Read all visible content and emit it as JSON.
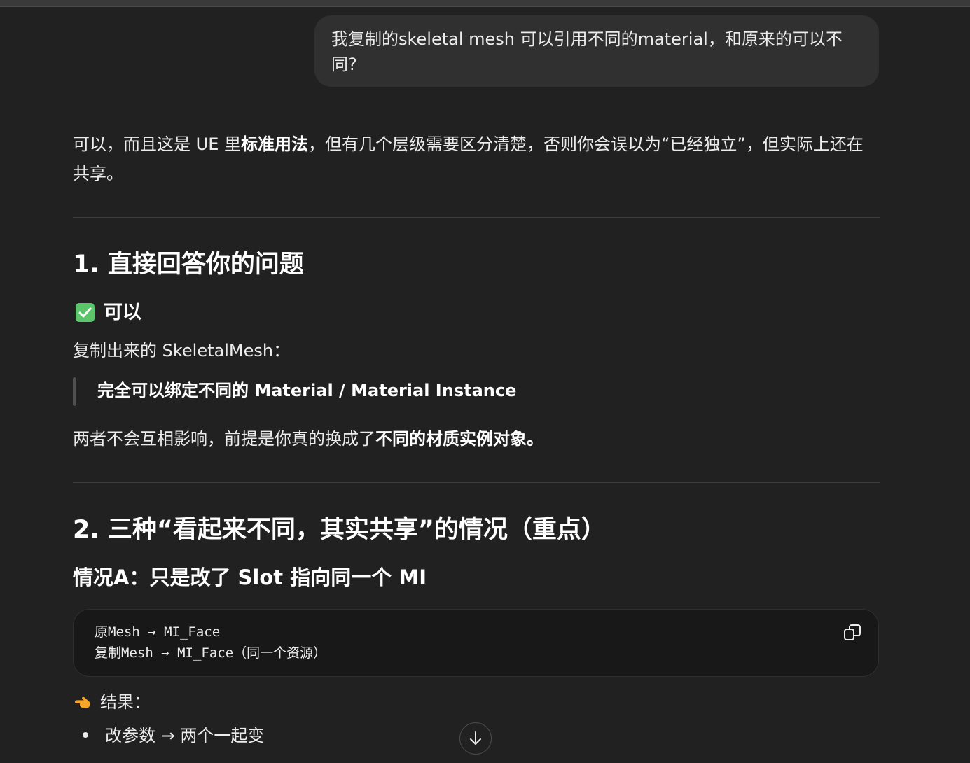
{
  "user_message": {
    "text": "我复制的skeletal mesh 可以引用不同的material，和原来的可以不同?"
  },
  "assistant": {
    "intro": {
      "part1": "可以，而且这是 UE 里",
      "bold1": "标准用法",
      "part2": "，但有几个层级需要区分清楚，否则你会误以为“已经独立”，但实际上还在共享。"
    },
    "section1": {
      "heading": "1. 直接回答你的问题",
      "check_label": "可以",
      "line": "复制出来的 SkeletalMesh：",
      "quote": "完全可以绑定不同的 Material / Material Instance",
      "para_part1": "两者不会互相影响，前提是你真的换成了",
      "para_bold": "不同的材质实例对象。"
    },
    "section2": {
      "heading": "2. 三种“看起来不同，其实共享”的情况（重点）",
      "sub_heading": "情况A：只是改了 Slot 指向同一个 MI",
      "code_lines": [
        "原Mesh → MI_Face",
        "复制Mesh → MI_Face（同一个资源）"
      ],
      "result_label": "结果：",
      "bullets": [
        "改参数 → 两个一起变"
      ]
    }
  },
  "icons": {
    "check": "check-mark-icon",
    "copy": "copy-icon",
    "pointer": "pointing-hand-icon",
    "scroll": "arrow-down-icon"
  },
  "colors": {
    "background": "#212121",
    "user_bubble": "#303030",
    "code_bg": "#181818",
    "check_green": "#5cc56b"
  }
}
